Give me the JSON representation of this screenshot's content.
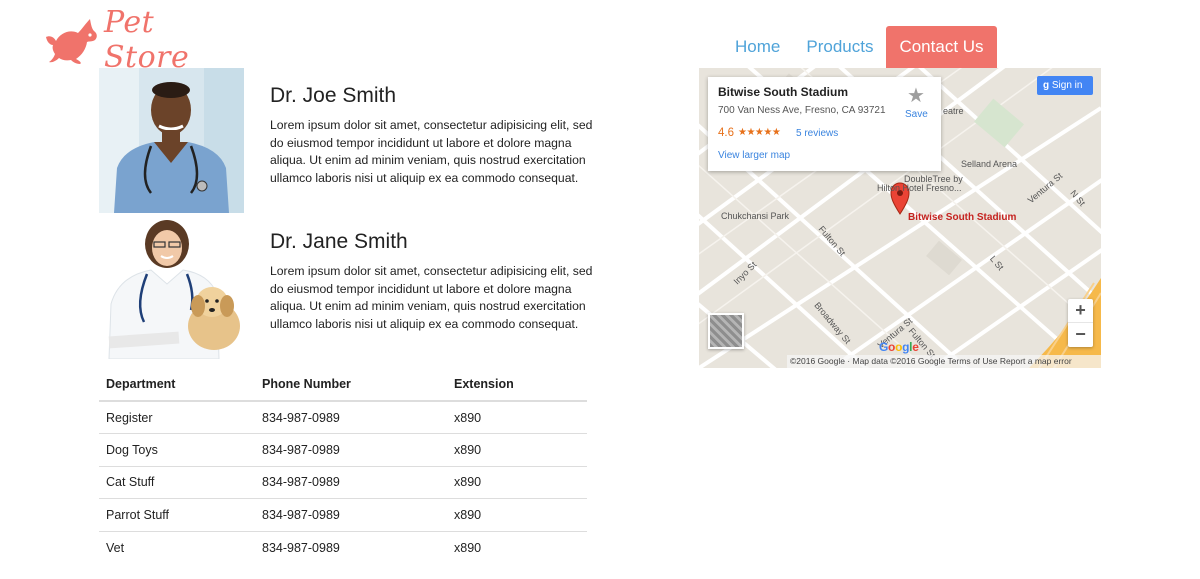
{
  "brand": {
    "name": "Pet Store",
    "color": "#f0736b",
    "icon": "running-dog-icon"
  },
  "nav": {
    "items": [
      {
        "label": "Home"
      },
      {
        "label": "Products"
      },
      {
        "label": "Contact Us",
        "active": true
      }
    ]
  },
  "doctors": [
    {
      "name": "Dr. Joe Smith",
      "bio": "Lorem ipsum dolor sit amet, consectetur adipisicing elit, sed do eiusmod tempor incididunt ut labore et dolore magna aliqua. Ut enim ad minim veniam, quis nostrud exercitation ullamco laboris nisi ut aliquip ex ea commodo consequat.",
      "photo": "male-doctor-photo"
    },
    {
      "name": "Dr. Jane Smith",
      "bio": "Lorem ipsum dolor sit amet, consectetur adipisicing elit, sed do eiusmod tempor incididunt ut labore et dolore magna aliqua. Ut enim ad minim veniam, quis nostrud exercitation ullamco laboris nisi ut aliquip ex ea commodo consequat.",
      "photo": "female-vet-with-puppy-photo"
    }
  ],
  "table": {
    "headers": [
      "Department",
      "Phone Number",
      "Extension"
    ],
    "rows": [
      [
        "Register",
        "834-987-0989",
        "x890"
      ],
      [
        "Dog Toys",
        "834-987-0989",
        "x890"
      ],
      [
        "Cat Stuff",
        "834-987-0989",
        "x890"
      ],
      [
        "Parrot Stuff",
        "834-987-0989",
        "x890"
      ],
      [
        "Vet",
        "834-987-0989",
        "x890"
      ]
    ]
  },
  "map": {
    "place_name": "Bitwise South Stadium",
    "address": "700 Van Ness Ave, Fresno, CA 93721",
    "rating": "4.6",
    "stars": "★★★★★",
    "reviews": "5 reviews",
    "view_larger": "View larger map",
    "save": "Save",
    "signin": "Sign in",
    "zoom_in": "+",
    "zoom_out": "−",
    "pin_label": "Bitwise South Stadium",
    "footer": "©2016 Google · Map data ©2016 Google   Terms of Use   Report a map error",
    "google": [
      "G",
      "o",
      "o",
      "g",
      "l",
      "e"
    ],
    "labels": {
      "chukchansi": "Chukchansi Park",
      "selland": "Selland Arena",
      "doubletree": "DoubleTree by",
      "hilton": "Hilton Hotel Fresno...",
      "fulton": "Fulton St",
      "inyo": "Inyo St",
      "broadway": "Broadway St",
      "ventura": "Ventura St",
      "nst": "N St",
      "lst": "L St",
      "theatre": "eatre",
      "ventura2": "Ventura St",
      "fulton2": "Fulton St"
    },
    "colors": {
      "road": "#ffffff",
      "land": "#e8e4dc",
      "highway": "#f6b94a",
      "pin": "#ea4335"
    }
  }
}
